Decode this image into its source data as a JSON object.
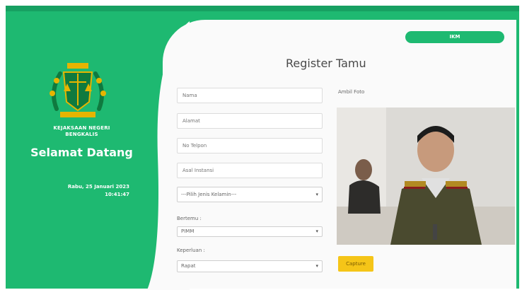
{
  "sidebar": {
    "institution_line1": "KEJAKSAAN NEGERI",
    "institution_line2": "BENGKALIS",
    "welcome": "Selamat Datang",
    "date": "Rabu, 25 Januari 2023",
    "time": "10:41:47"
  },
  "top_pill": "IKM",
  "page_title": "Register Tamu",
  "form": {
    "nama_placeholder": "Nama",
    "alamat_placeholder": "Alamat",
    "telepon_placeholder": "No Telpon",
    "instansi_placeholder": "Asal Instansi",
    "gender_select": "---Pilih Jenis Kelamin---",
    "bertemu_label": "Bertemu :",
    "bertemu_value": "PIMM",
    "keperluan_label": "Keperluan :",
    "keperluan_value": "Rapat"
  },
  "photo": {
    "label": "Ambil Foto",
    "capture_button": "Capture"
  },
  "colors": {
    "primary_green": "#1eb971",
    "capture_yellow": "#f5c518"
  },
  "icons": [
    "emblem-logo",
    "chevron-down-icon"
  ]
}
